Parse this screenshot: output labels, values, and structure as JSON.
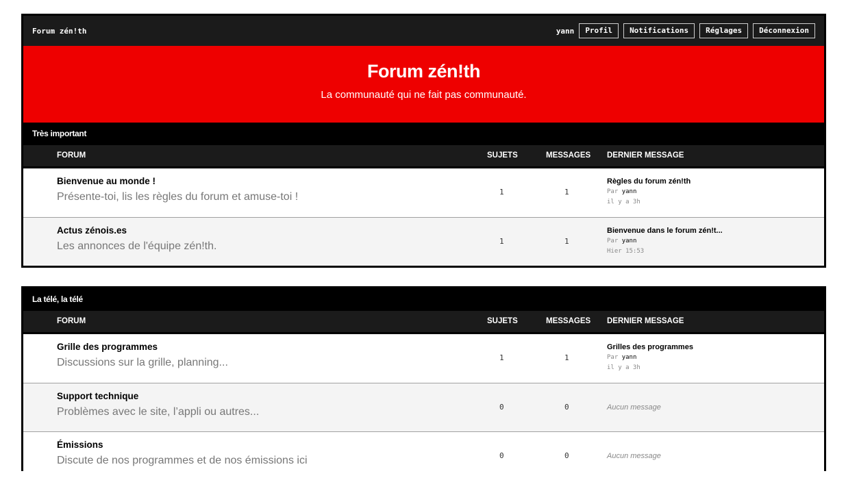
{
  "header": {
    "site_name": "Forum zén!th",
    "username": "yann",
    "nav": [
      "Profil",
      "Notifications",
      "Réglages",
      "Déconnexion"
    ]
  },
  "hero": {
    "title": "Forum zén!th",
    "tagline": "La communauté qui ne fait pas communauté."
  },
  "columns": {
    "forum": "FORUM",
    "sujets": "SUJETS",
    "messages": "MESSAGES",
    "last": "DERNIER MESSAGE"
  },
  "categories": [
    {
      "title": "Très important",
      "forums": [
        {
          "name": "Bienvenue au monde !",
          "description": "Présente-toi, lis les règles du forum et amuse-toi !",
          "sujets": "1",
          "messages": "1",
          "last_title": "Règles du forum zén!th",
          "last_by_prefix": "Par",
          "last_by": "yann",
          "last_when": "il y a 3h"
        },
        {
          "name": "Actus zénois.es",
          "description": "Les annonces de l'équipe zén!th.",
          "sujets": "1",
          "messages": "1",
          "last_title": "Bienvenue dans le forum zén!t...",
          "last_by_prefix": "Par",
          "last_by": "yann",
          "last_when": "Hier 15:53"
        }
      ]
    },
    {
      "title": "La télé, la télé",
      "forums": [
        {
          "name": "Grille des programmes",
          "description": "Discussions sur la grille, planning...",
          "sujets": "1",
          "messages": "1",
          "last_title": "Grilles des programmes",
          "last_by_prefix": "Par",
          "last_by": "yann",
          "last_when": "il y a 3h"
        },
        {
          "name": "Support technique",
          "description": "Problèmes avec le site, l’appli ou autres...",
          "sujets": "0",
          "messages": "0",
          "no_message": "Aucun message"
        },
        {
          "name": "Émissions",
          "description": "Discute de nos programmes et de nos émissions ici",
          "sujets": "0",
          "messages": "0",
          "no_message": "Aucun message"
        }
      ]
    }
  ]
}
